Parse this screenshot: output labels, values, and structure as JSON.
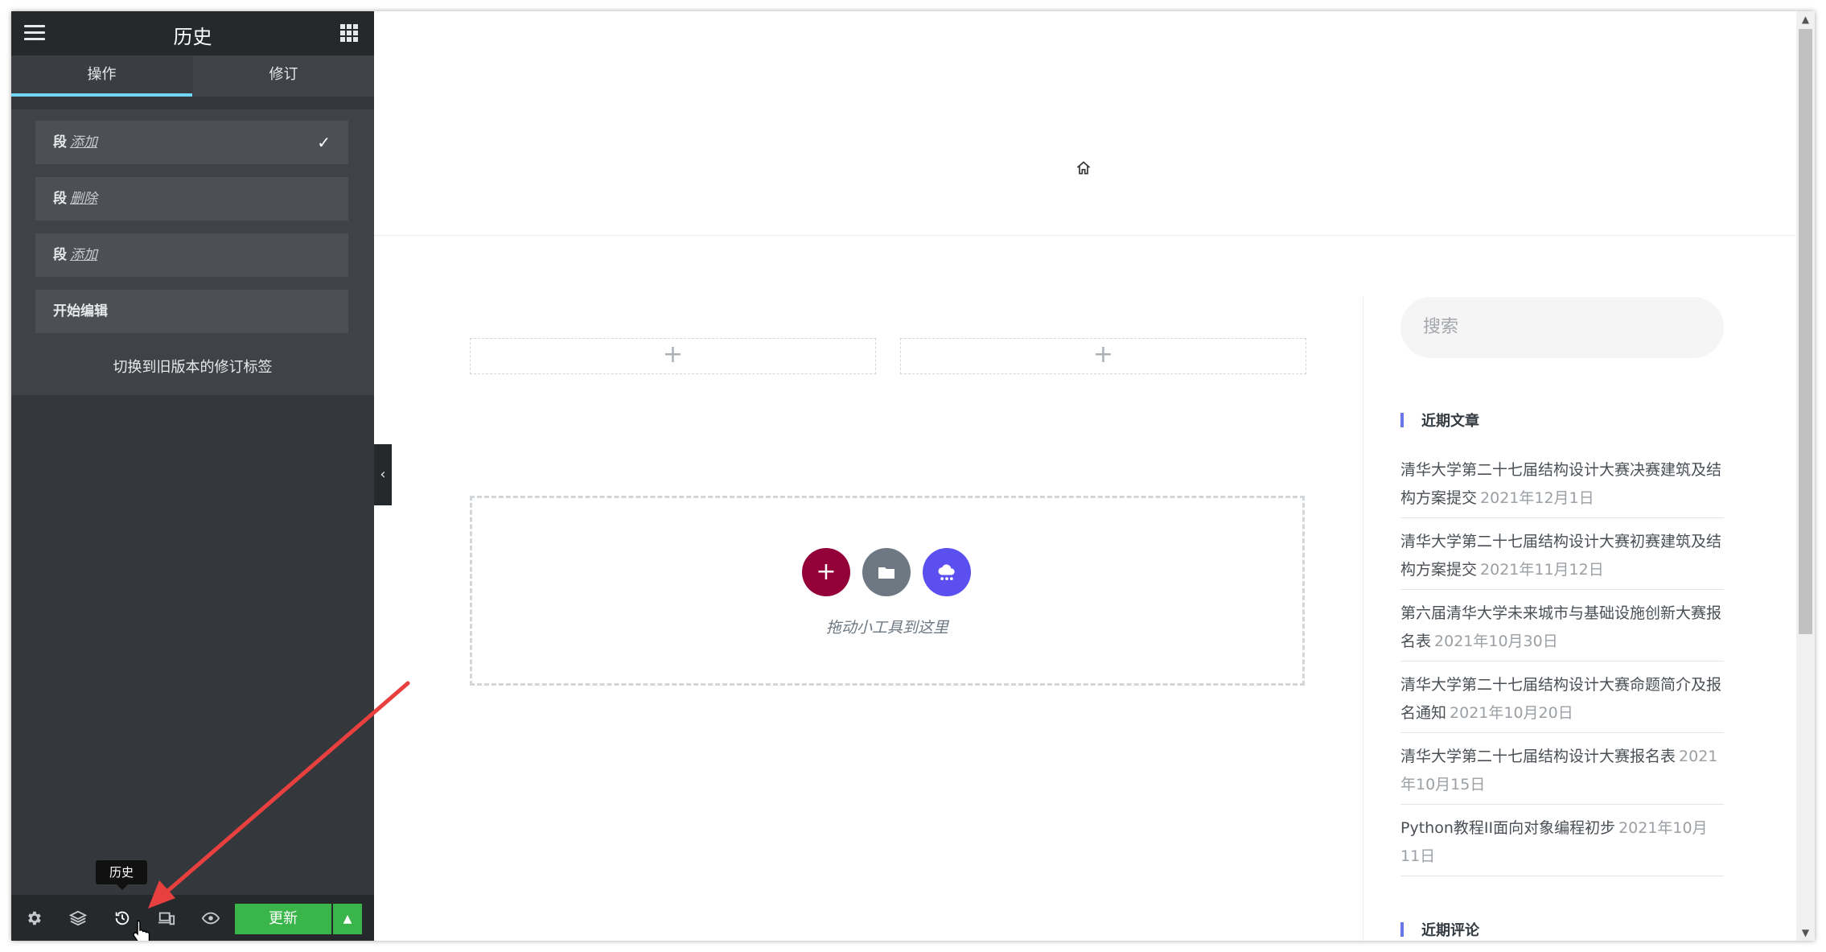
{
  "sidebar": {
    "title": "历史",
    "tabs": [
      {
        "label": "操作"
      },
      {
        "label": "修订"
      }
    ],
    "history_items": [
      {
        "bold": "段",
        "action": "添加",
        "current": true
      },
      {
        "bold": "段",
        "action": "删除",
        "current": false
      },
      {
        "bold": "段",
        "action": "添加",
        "current": false
      },
      {
        "bold": "开始编辑",
        "action": "",
        "current": false
      }
    ],
    "revert_link": "切换到旧版本的修订标签",
    "tooltip": "历史",
    "update_button": "更新"
  },
  "canvas": {
    "drop_text": "拖动小工具到这里",
    "search_placeholder": "搜索",
    "recent_posts_title": "近期文章",
    "recent_posts": [
      {
        "title": "清华大学第二十七届结构设计大赛决赛建筑及结构方案提交",
        "date": "2021年12月1日"
      },
      {
        "title": "清华大学第二十七届结构设计大赛初赛建筑及结构方案提交",
        "date": "2021年11月12日"
      },
      {
        "title": "第六届清华大学未来城市与基础设施创新大赛报名表",
        "date": "2021年10月30日"
      },
      {
        "title": "清华大学第二十七届结构设计大赛命题简介及报名通知",
        "date": "2021年10月20日"
      },
      {
        "title": "清华大学第二十七届结构设计大赛报名表",
        "date": "2021年10月15日"
      },
      {
        "title": "Python教程II面向对象编程初步",
        "date": "2021年10月11日"
      }
    ],
    "recent_comments_title": "近期评论"
  },
  "colors": {
    "accent_tab": "#71d7f7",
    "update_green": "#39b54a",
    "add_btn": "#93003a",
    "folder_btn": "#6d7882",
    "cloud_btn": "#5b4ff0",
    "arrow": "#e8403f"
  }
}
